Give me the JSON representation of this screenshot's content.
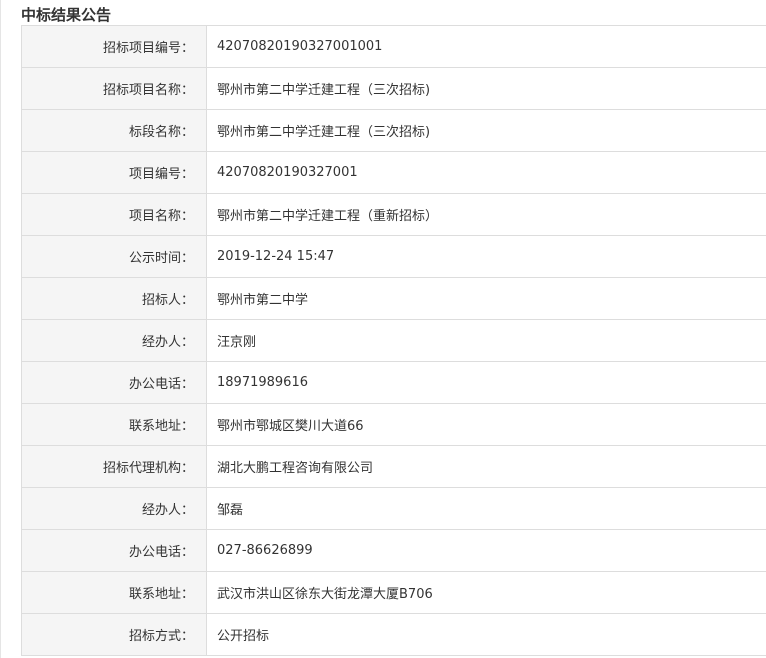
{
  "announcement": {
    "title": "中标结果公告",
    "rows": [
      {
        "label": "招标项目编号：",
        "value": "42070820190327001001"
      },
      {
        "label": "招标项目名称：",
        "value": "鄂州市第二中学迁建工程（三次招标)"
      },
      {
        "label": "标段名称：",
        "value": "鄂州市第二中学迁建工程（三次招标)"
      },
      {
        "label": "项目编号：",
        "value": "42070820190327001"
      },
      {
        "label": "项目名称：",
        "value": "鄂州市第二中学迁建工程（重新招标）"
      },
      {
        "label": "公示时间：",
        "value": "2019-12-24 15:47"
      },
      {
        "label": "招标人：",
        "value": "鄂州市第二中学"
      },
      {
        "label": "经办人：",
        "value": "汪京刚"
      },
      {
        "label": "办公电话：",
        "value": "18971989616"
      },
      {
        "label": "联系地址：",
        "value": "鄂州市鄂城区樊川大道66"
      },
      {
        "label": "招标代理机构：",
        "value": "湖北大鹏工程咨询有限公司"
      },
      {
        "label": "经办人：",
        "value": "邹磊"
      },
      {
        "label": "办公电话：",
        "value": "027-86626899"
      },
      {
        "label": "联系地址：",
        "value": "武汉市洪山区徐东大街龙潭大厦B706"
      },
      {
        "label": "招标方式：",
        "value": "公开招标"
      }
    ]
  }
}
